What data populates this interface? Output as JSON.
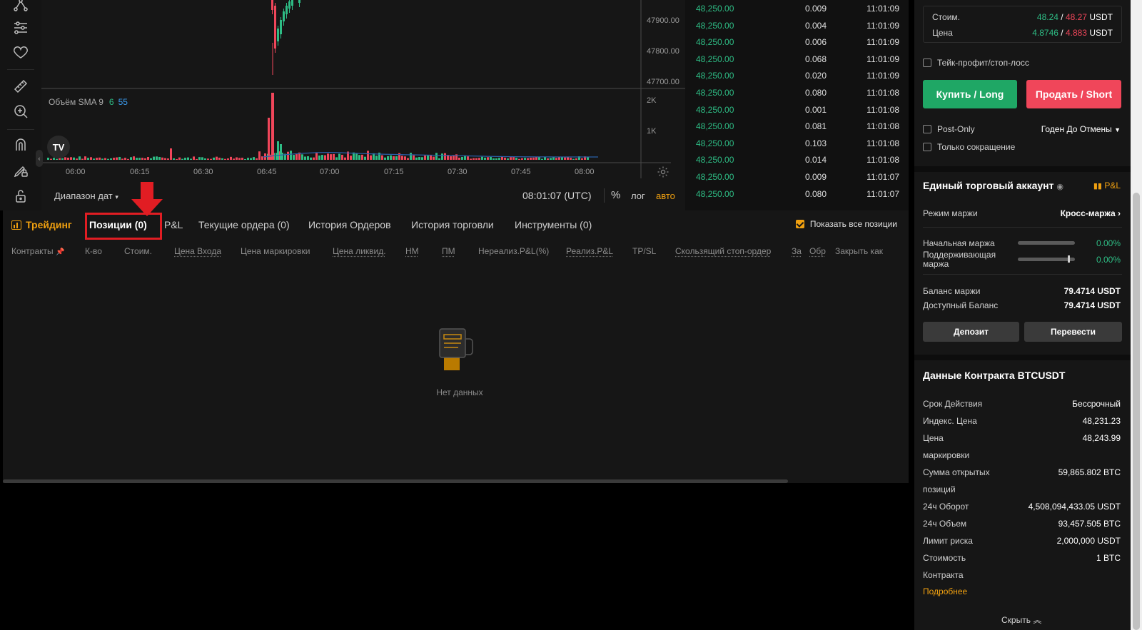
{
  "chart": {
    "price_axis": [
      "47900.00",
      "47800.00",
      "47700.00"
    ],
    "volume_axis": [
      "2K",
      "1K"
    ],
    "time_axis": [
      "06:00",
      "06:15",
      "06:30",
      "06:45",
      "07:00",
      "07:15",
      "07:30",
      "07:45",
      "08:00"
    ],
    "sma_label": "Объём SMA 9",
    "sma_value_1": "6",
    "sma_value_2": "55",
    "date_range_label": "Диапазон дат",
    "current_time": "08:01:07 (UTC)",
    "percent_label": "%",
    "log_label": "лог",
    "auto_label": "авто",
    "logo_text": "TV"
  },
  "trades": [
    {
      "price": "48,250.00",
      "qty": "0.009",
      "time": "11:01:09"
    },
    {
      "price": "48,250.00",
      "qty": "0.004",
      "time": "11:01:09"
    },
    {
      "price": "48,250.00",
      "qty": "0.006",
      "time": "11:01:09"
    },
    {
      "price": "48,250.00",
      "qty": "0.068",
      "time": "11:01:09"
    },
    {
      "price": "48,250.00",
      "qty": "0.020",
      "time": "11:01:09"
    },
    {
      "price": "48,250.00",
      "qty": "0.080",
      "time": "11:01:08"
    },
    {
      "price": "48,250.00",
      "qty": "0.001",
      "time": "11:01:08"
    },
    {
      "price": "48,250.00",
      "qty": "0.081",
      "time": "11:01:08"
    },
    {
      "price": "48,250.00",
      "qty": "0.103",
      "time": "11:01:08"
    },
    {
      "price": "48,250.00",
      "qty": "0.014",
      "time": "11:01:08"
    },
    {
      "price": "48,250.00",
      "qty": "0.009",
      "time": "11:01:07"
    },
    {
      "price": "48,250.00",
      "qty": "0.080",
      "time": "11:01:07"
    }
  ],
  "bottom": {
    "tabs": {
      "trading": "Трейдинг",
      "positions": "Позиции (0)",
      "pnl": "P&L",
      "open_orders": "Текущие ордера (0)",
      "order_history": "История Ордеров",
      "trade_history": "История торговли",
      "instruments": "Инструменты (0)"
    },
    "show_all_positions": "Показать все позиции",
    "columns": {
      "contracts": "Контракты",
      "qty": "К-во",
      "value": "Стоим.",
      "entry_price": "Цена Входа",
      "mark_price": "Цена маркировки",
      "liq_price": "Цена ликвид.",
      "im": "НМ",
      "mm": "ПМ",
      "unrealized_pnl": "Нереализ.P&L(%)",
      "realized_pnl": "Реализ.P&L",
      "tpsl": "TP/SL",
      "trailing_stop": "Скользящий стоп-ордер",
      "col_za": "За",
      "col_obr": "Обр",
      "close_as": "Закрыть как"
    },
    "empty_text": "Нет данных"
  },
  "order_panel": {
    "cost_label": "Стоим.",
    "cost_buy": "48.24",
    "cost_sell": "48.27",
    "cost_unit": "USDT",
    "price_label": "Цена",
    "price_buy": "4.8746",
    "price_sell": "4.883",
    "price_unit": "USDT",
    "slash": "/",
    "tpsl_label": "Тейк-профит/стоп-лосс",
    "buy_button": "Купить / Long",
    "sell_button": "Продать / Short",
    "post_only": "Post-Only",
    "time_in_force": "Годен До Отмены",
    "reduce_only": "Только сокращение"
  },
  "account": {
    "title": "Единый торговый аккаунт",
    "pnl_link": "P&L",
    "margin_mode_label": "Режим маржи",
    "margin_mode_value": "Кросс-маржа",
    "initial_margin_label": "Начальная маржа",
    "initial_margin_value": "0.00%",
    "maintenance_margin_label": "Поддерживающая маржа",
    "maintenance_margin_value": "0.00%",
    "margin_balance_label": "Баланс маржи",
    "margin_balance_value": "79.4714 USDT",
    "available_balance_label": "Доступный Баланс",
    "available_balance_value": "79.4714 USDT",
    "deposit_button": "Депозит",
    "transfer_button": "Перевести"
  },
  "contract": {
    "title": "Данные Контракта BTCUSDT",
    "expiry_label": "Срок Действия",
    "expiry_value": "Бессрочный",
    "index_price_label": "Индекс. Цена",
    "index_price_value": "48,231.23",
    "mark_price_label_1": "Цена",
    "mark_price_label_2": "маркировки",
    "mark_price_value": "48,243.99",
    "open_interest_label_1": "Сумма открытых",
    "open_interest_label_2": "позиций",
    "open_interest_value": "59,865.802 BTC",
    "turnover_label": "24ч Оборот",
    "turnover_value": "4,508,094,433.05 USDT",
    "volume_label": "24ч Объем",
    "volume_value": "93,457.505 BTC",
    "risk_limit_label": "Лимит риска",
    "risk_limit_value": "2,000,000 USDT",
    "contract_value_label_1": "Стоимость",
    "contract_value_label_2": "Контракта",
    "contract_value_value": "1 BTC",
    "more_link": "Подробнее",
    "hide_link": "Скрыть"
  },
  "colors": {
    "accent": "#f0a010",
    "buy": "#1fa765",
    "sell": "#f0465a",
    "highlight": "#e11d23"
  }
}
